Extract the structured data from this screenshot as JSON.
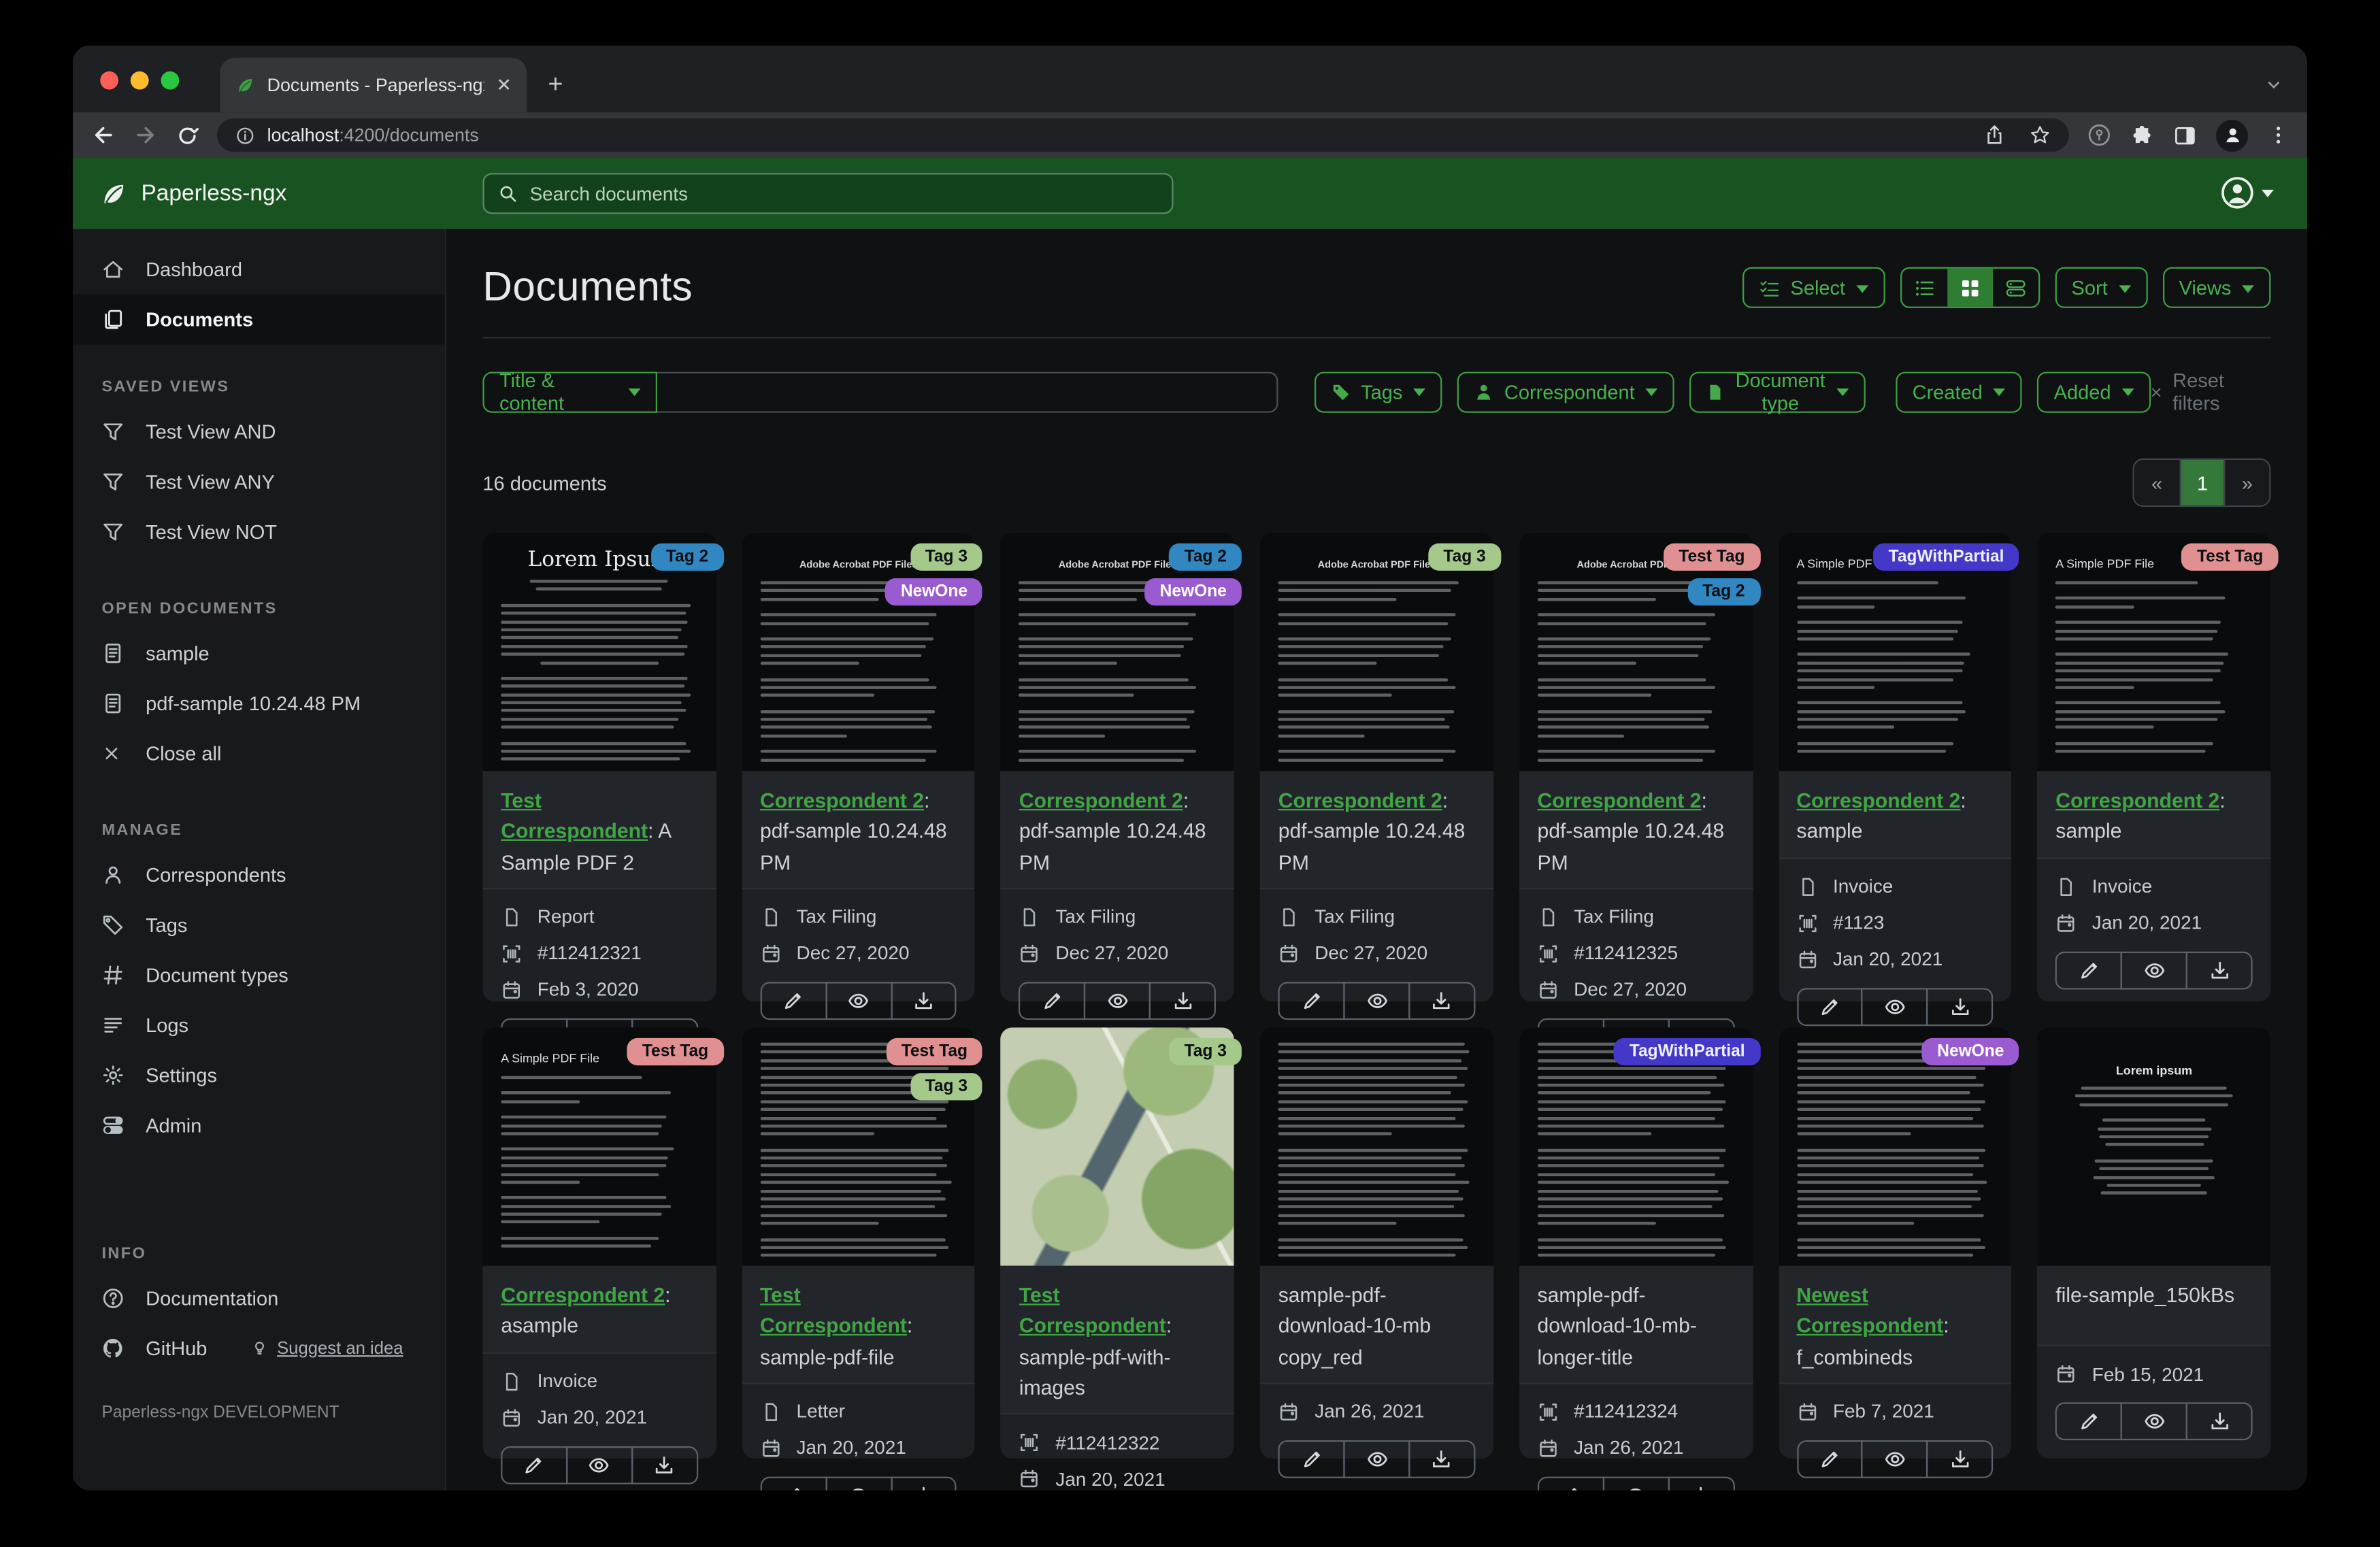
{
  "browser": {
    "tab_title": "Documents - Paperless-ngx",
    "url_host": "localhost",
    "url_path": ":4200/documents"
  },
  "header": {
    "app_name": "Paperless-ngx",
    "search_placeholder": "Search documents"
  },
  "sidebar": {
    "nav": [
      {
        "icon": "home-icon",
        "label": "Dashboard",
        "active": false
      },
      {
        "icon": "documents-icon",
        "label": "Documents",
        "active": true
      }
    ],
    "saved_views_header": "SAVED VIEWS",
    "saved_views": [
      {
        "icon": "funnel-icon",
        "label": "Test View AND"
      },
      {
        "icon": "funnel-icon",
        "label": "Test View ANY"
      },
      {
        "icon": "funnel-icon",
        "label": "Test View NOT"
      }
    ],
    "open_documents_header": "OPEN DOCUMENTS",
    "open_documents": [
      {
        "icon": "doc-icon",
        "label": "sample"
      },
      {
        "icon": "doc-icon",
        "label": "pdf-sample 10.24.48 PM"
      }
    ],
    "close_all_label": "Close all",
    "manage_header": "MANAGE",
    "manage": [
      {
        "icon": "person-icon",
        "label": "Correspondents"
      },
      {
        "icon": "tag-icon",
        "label": "Tags"
      },
      {
        "icon": "hash-icon",
        "label": "Document types"
      },
      {
        "icon": "logs-icon",
        "label": "Logs"
      },
      {
        "icon": "gear-icon",
        "label": "Settings"
      },
      {
        "icon": "admin-icon",
        "label": "Admin"
      }
    ],
    "info_header": "INFO",
    "info": [
      {
        "icon": "question-icon",
        "label": "Documentation"
      },
      {
        "icon": "github-icon",
        "label": "GitHub"
      }
    ],
    "suggest_label": "Suggest an idea",
    "footer": "Paperless-ngx DEVELOPMENT"
  },
  "toolbar": {
    "title": "Documents",
    "select_label": "Select",
    "sort_label": "Sort",
    "views_label": "Views"
  },
  "filters": {
    "field_label": "Title & content",
    "tags_label": "Tags",
    "correspondent_label": "Correspondent",
    "doctype_label": "Document type",
    "created_label": "Created",
    "added_label": "Added",
    "reset_label": "Reset filters"
  },
  "status": {
    "count_text": "16 documents",
    "page_prev": "«",
    "page_current": "1",
    "page_next": "»"
  },
  "tag_palette": {
    "Tag 2": {
      "bg": "#3087c1",
      "fg": "#0c1013"
    },
    "Tag 3": {
      "bg": "#a5c88b",
      "fg": "#0c1013"
    },
    "NewOne": {
      "bg": "#9b5bd0",
      "fg": "#ffffff"
    },
    "Test Tag": {
      "bg": "#e09090",
      "fg": "#0c1013"
    },
    "TagWithPartial": {
      "bg": "#4438c9",
      "fg": "#f0efff"
    }
  },
  "cards": [
    {
      "thumb": "lorem",
      "thumb_heading": "Lorem Ipsum",
      "tags": [
        "Tag 2"
      ],
      "title_link": "Test Correspondent",
      "title_rest": ": A Sample PDF 2",
      "type": "Report",
      "asn": "#112412321",
      "date": "Feb 3, 2020"
    },
    {
      "thumb": "acrobat",
      "thumb_heading": "Adobe Acrobat PDF Files",
      "tags": [
        "Tag 3",
        "NewOne"
      ],
      "title_link": "Correspondent 2",
      "title_rest": ": pdf-sample 10.24.48 PM",
      "type": "Tax Filing",
      "asn": "",
      "date": "Dec 27, 2020"
    },
    {
      "thumb": "acrobat",
      "thumb_heading": "Adobe Acrobat PDF Files",
      "tags": [
        "Tag 2",
        "NewOne"
      ],
      "title_link": "Correspondent 2",
      "title_rest": ": pdf-sample 10.24.48 PM",
      "type": "Tax Filing",
      "asn": "",
      "date": "Dec 27, 2020"
    },
    {
      "thumb": "acrobat",
      "thumb_heading": "Adobe Acrobat PDF Files",
      "tags": [
        "Tag 3"
      ],
      "title_link": "Correspondent 2",
      "title_rest": ": pdf-sample 10.24.48 PM",
      "type": "Tax Filing",
      "asn": "",
      "date": "Dec 27, 2020"
    },
    {
      "thumb": "acrobat",
      "thumb_heading": "Adobe Acrobat PDF Files",
      "tags": [
        "Test Tag",
        "Tag 2"
      ],
      "title_link": "Correspondent 2",
      "title_rest": ": pdf-sample 10.24.48 PM",
      "type": "Tax Filing",
      "asn": "#112412325",
      "date": "Dec 27, 2020"
    },
    {
      "thumb": "simple",
      "thumb_heading": "A Simple PDF File",
      "tags": [
        "TagWithPartial"
      ],
      "title_link": "Correspondent 2",
      "title_rest": ": sample",
      "type": "Invoice",
      "asn": "#1123",
      "date": "Jan 20, 2021"
    },
    {
      "thumb": "simple",
      "thumb_heading": "A Simple PDF File",
      "tags": [
        "Test Tag"
      ],
      "title_link": "Correspondent 2",
      "title_rest": ": sample",
      "type": "Invoice",
      "asn": "",
      "date": "Jan 20, 2021"
    },
    {
      "thumb": "simple",
      "thumb_heading": "A Simple PDF File",
      "tags": [
        "Test Tag"
      ],
      "title_link": "Correspondent 2",
      "title_rest": ": asample",
      "type": "Invoice",
      "asn": "",
      "date": "Jan 20, 2021"
    },
    {
      "thumb": "dense",
      "thumb_heading": "",
      "tags": [
        "Test Tag",
        "Tag 3"
      ],
      "title_link": "Test Correspondent",
      "title_rest": ": sample-pdf-file",
      "type": "Letter",
      "asn": "",
      "date": "Jan 20, 2021"
    },
    {
      "thumb": "map",
      "thumb_heading": "",
      "tags": [
        "Tag 3"
      ],
      "title_link": "Test Correspondent",
      "title_rest": ": sample-pdf-with-images",
      "type": "",
      "asn": "#112412322",
      "date": "Jan 20, 2021"
    },
    {
      "thumb": "dense",
      "thumb_heading": "",
      "tags": [],
      "title_link": "",
      "title_rest": "sample-pdf-download-10-mb copy_red",
      "type": "",
      "asn": "",
      "date": "Jan 26, 2021"
    },
    {
      "thumb": "dense",
      "thumb_heading": "",
      "tags": [
        "TagWithPartial"
      ],
      "title_link": "",
      "title_rest": "sample-pdf-download-10-mb-longer-title",
      "type": "",
      "asn": "#112412324",
      "date": "Jan 26, 2021"
    },
    {
      "thumb": "dense",
      "thumb_heading": "",
      "tags": [
        "NewOne"
      ],
      "title_link": "Newest Correspondent",
      "title_rest": ": f_combineds",
      "type": "",
      "asn": "",
      "date": "Feb 7, 2021"
    },
    {
      "thumb": "lorem-center",
      "thumb_heading": "Lorem ipsum",
      "tags": [],
      "title_link": "",
      "title_rest": "file-sample_150kBs",
      "type": "",
      "asn": "",
      "date": "Feb 15, 2021"
    }
  ]
}
